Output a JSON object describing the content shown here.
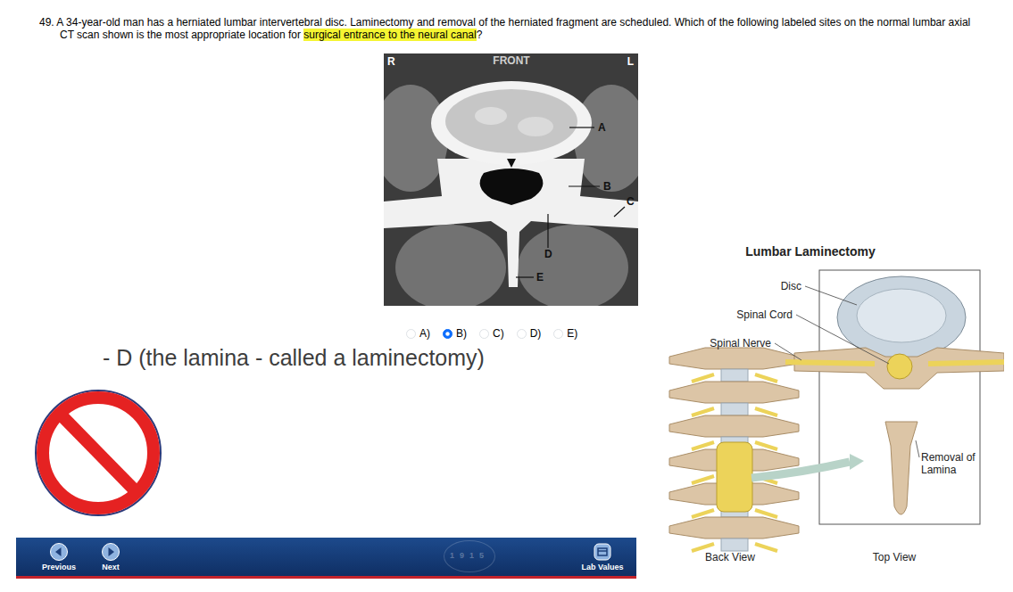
{
  "question": {
    "number": "49.",
    "text": "A 34-year-old man has a herniated lumbar intervertebral disc. Laminectomy and removal of the herniated fragment are scheduled. Which of the following labeled sites on the normal lumbar axial CT scan shown is the most appropriate location for ",
    "highlight": "surgical entrance to the neural canal",
    "end": "?"
  },
  "ct_scan": {
    "right": "R",
    "front": "FRONT",
    "left": "L",
    "labels": [
      {
        "letter": "A"
      },
      {
        "letter": "B"
      },
      {
        "letter": "C"
      },
      {
        "letter": "D"
      },
      {
        "letter": "E"
      }
    ]
  },
  "options": [
    {
      "label": "A)",
      "selected": false
    },
    {
      "label": "B)",
      "selected": true
    },
    {
      "label": "C)",
      "selected": false
    },
    {
      "label": "D)",
      "selected": false
    },
    {
      "label": "E)",
      "selected": false
    }
  ],
  "annotation": "- D (the lamina - called a laminectomy)",
  "nav": {
    "previous": "Previous",
    "next": "Next",
    "seal": "1915",
    "lab_values": "Lab Values"
  },
  "illustration": {
    "title": "Lumbar Laminectomy",
    "disc": "Disc",
    "spinal_cord": "Spinal Cord",
    "spinal_nerve": "Spinal Nerve",
    "removal": "Removal of Lamina",
    "back_view": "Back View",
    "top_view": "Top View"
  }
}
